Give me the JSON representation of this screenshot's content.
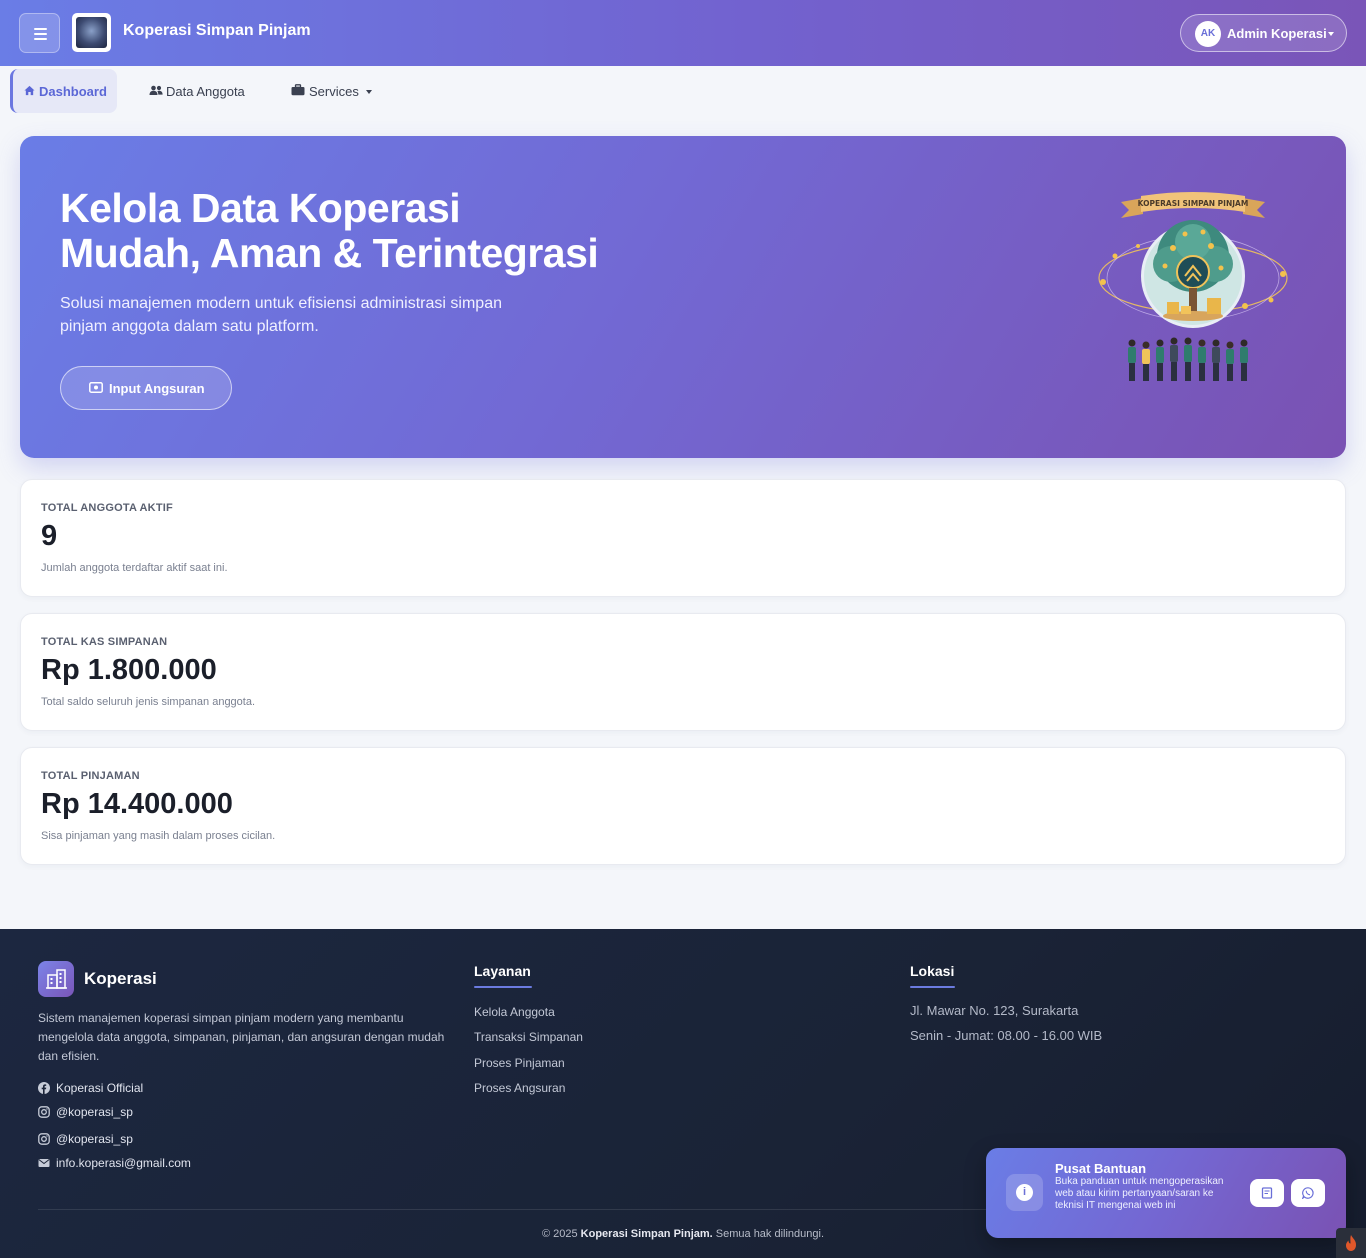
{
  "header": {
    "brand": "Koperasi Simpan Pinjam",
    "user_initials": "AK",
    "user_name": "Admin Koperasi"
  },
  "nav": {
    "dashboard": "Dashboard",
    "members": "Data Anggota",
    "services": "Services"
  },
  "hero": {
    "title_line1": "Kelola Data Koperasi",
    "title_line2": "Mudah, Aman & Terintegrasi",
    "subtitle": "Solusi manajemen modern untuk efisiensi administrasi simpan pinjam anggota dalam satu platform.",
    "button": "Input Angsuran",
    "illustration_banner": "KOPERASI SIMPAN PINJAM"
  },
  "stats": [
    {
      "label": "TOTAL ANGGOTA AKTIF",
      "value": "9",
      "desc": "Jumlah anggota terdaftar aktif saat ini."
    },
    {
      "label": "TOTAL KAS SIMPANAN",
      "value": "Rp 1.800.000",
      "desc": "Total saldo seluruh jenis simpanan anggota."
    },
    {
      "label": "TOTAL PINJAMAN",
      "value": "Rp 14.400.000",
      "desc": "Sisa pinjaman yang masih dalam proses cicilan."
    }
  ],
  "footer": {
    "brand": "Koperasi",
    "about": "Sistem manajemen koperasi simpan pinjam modern yang membantu mengelola data anggota, simpanan, pinjaman, dan angsuran dengan mudah dan efisien.",
    "social": {
      "facebook": "Koperasi Official",
      "instagram1": "@koperasi_sp",
      "instagram2": "@koperasi_sp",
      "email": "info.koperasi@gmail.com"
    },
    "services_title": "Layanan",
    "services": [
      "Kelola Anggota",
      "Transaksi Simpanan",
      "Proses Pinjaman",
      "Proses Angsuran"
    ],
    "location_title": "Lokasi",
    "address": "Jl. Mawar No. 123, Surakarta",
    "hours": "Senin - Jumat: 08.00 - 16.00 WIB",
    "copyright_prefix": "© 2025",
    "copyright_brand": "Koperasi Simpan Pinjam.",
    "copyright_suffix": "Semua hak dilindungi."
  },
  "help": {
    "title": "Pusat Bantuan",
    "text": "Buka panduan untuk mengoperasikan web atau kirim pertanyaan/saran ke teknisi IT mengenai web ini"
  },
  "colors": {
    "primary": "#6a7de6",
    "secondary": "#7a55b8",
    "footer_bg": "#1a2336",
    "page_bg": "#f4f6fa"
  }
}
